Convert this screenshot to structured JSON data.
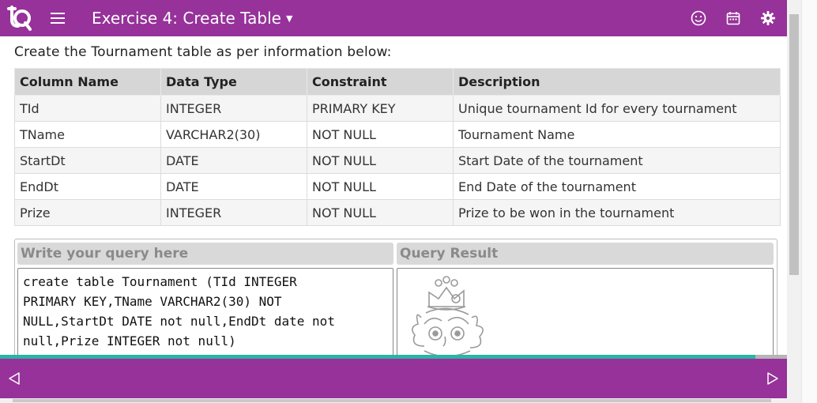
{
  "header": {
    "title": "Exercise 4: Create Table",
    "icons": [
      "logo-icon",
      "menu-icon",
      "smiley-icon",
      "calendar-icon",
      "settings-icon"
    ]
  },
  "main": {
    "intro": "Create the Tournament table as per information below:",
    "table": {
      "columns": [
        "Column Name",
        "Data Type",
        "Constraint",
        "Description"
      ],
      "rows": [
        [
          "TId",
          "INTEGER",
          "PRIMARY KEY",
          "Unique tournament Id for every tournament"
        ],
        [
          "TName",
          "VARCHAR2(30)",
          "NOT NULL",
          "Tournament Name"
        ],
        [
          "StartDt",
          "DATE",
          "NOT NULL",
          "Start Date of the tournament"
        ],
        [
          "EndDt",
          "DATE",
          "NOT NULL",
          "End Date of the tournament"
        ],
        [
          "Prize",
          "INTEGER",
          "NOT NULL",
          "Prize to be won in the tournament"
        ]
      ]
    }
  },
  "query": {
    "header": "Write your query here",
    "text": "create table Tournament (TId INTEGER\nPRIMARY KEY,TName VARCHAR2(30) NOT\nNULL,StartDt DATE not null,EndDt date not\nnull,Prize INTEGER not null)"
  },
  "result": {
    "header": "Query Result"
  },
  "progress": {
    "fraction": 0.96
  },
  "colors": {
    "brand": "#96329a",
    "progress": "#2bb3a3"
  }
}
